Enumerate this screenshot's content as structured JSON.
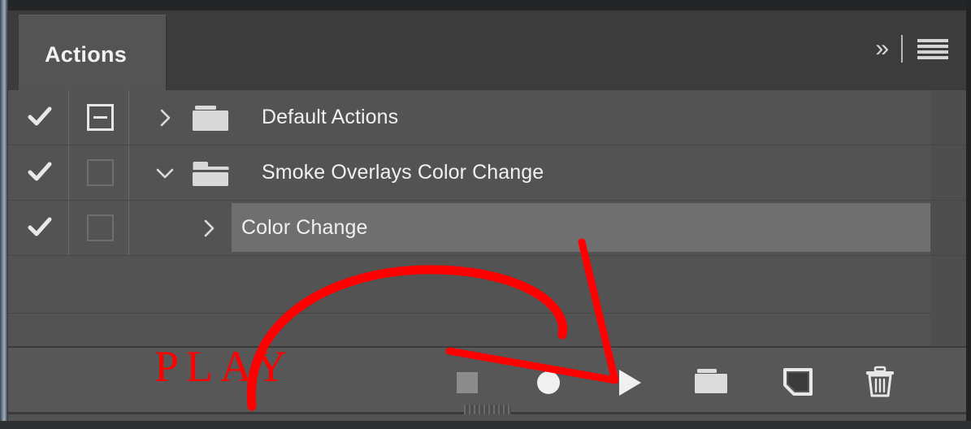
{
  "panel": {
    "tab_label": "Actions",
    "collapse_icon": "double-chevron-right-icon",
    "menu_icon": "hamburger-menu-icon"
  },
  "list": {
    "rows": [
      {
        "label": "Default Actions",
        "checked": true,
        "dialog_toggle": "partial",
        "expanded": false,
        "twisty_icon": "chevron-right-icon",
        "folder_icon": "folder-closed-icon",
        "indent": 0,
        "selected": false
      },
      {
        "label": "Smoke Overlays Color Change",
        "checked": true,
        "dialog_toggle": "off",
        "expanded": true,
        "twisty_icon": "chevron-down-icon",
        "folder_icon": "folder-open-icon",
        "indent": 0,
        "selected": false
      },
      {
        "label": "Color Change",
        "checked": true,
        "dialog_toggle": "off",
        "expanded": false,
        "twisty_icon": "chevron-right-icon",
        "folder_icon": "none",
        "indent": 1,
        "selected": true
      }
    ]
  },
  "toolbar": {
    "buttons": [
      {
        "name": "stop-button",
        "icon": "stop-square-icon",
        "enabled": false
      },
      {
        "name": "record-button",
        "icon": "record-circle-icon",
        "enabled": true
      },
      {
        "name": "play-button",
        "icon": "play-triangle-icon",
        "enabled": true
      },
      {
        "name": "new-set-button",
        "icon": "folder-icon",
        "enabled": true
      },
      {
        "name": "new-action-button",
        "icon": "new-page-icon",
        "enabled": true
      },
      {
        "name": "delete-button",
        "icon": "trash-icon",
        "enabled": true
      }
    ]
  },
  "annotations": {
    "label": "PLAY",
    "color": "#ff0000",
    "arrow_target": "play-button"
  },
  "colors": {
    "panel_bg": "#535353",
    "header_bg": "#3c3c3c",
    "tab_bg": "#545454",
    "toolbar_bg": "#575757",
    "selection_bg": "#6f6f6f",
    "text": "#f0f0f0",
    "annotation_red": "#ff0000"
  }
}
